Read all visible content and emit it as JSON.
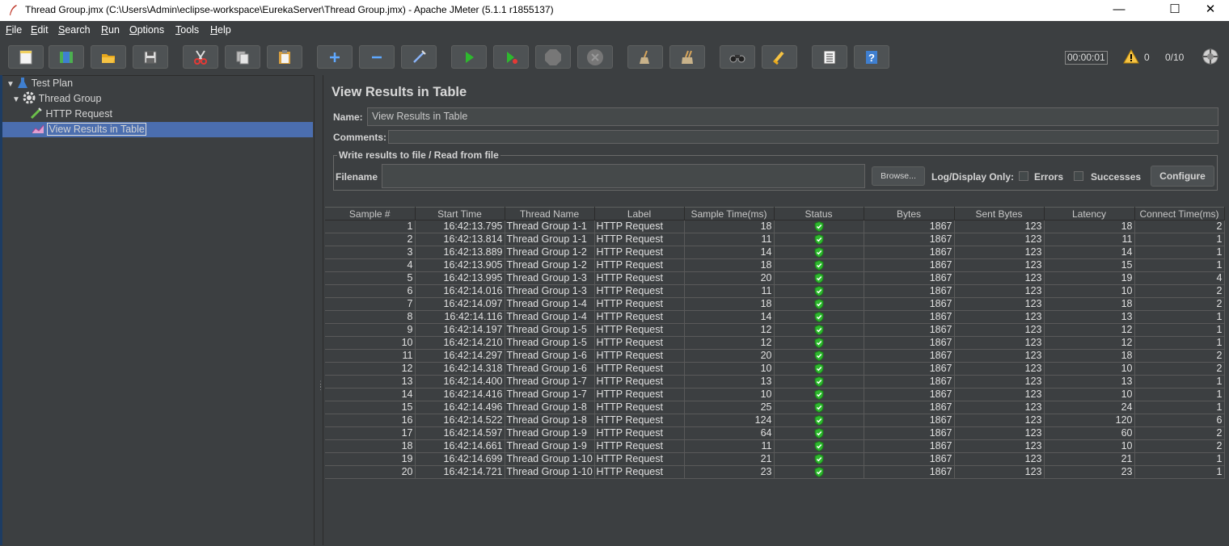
{
  "window": {
    "title": "Thread Group.jmx (C:\\Users\\Admin\\eclipse-workspace\\EurekaServer\\Thread Group.jmx) - Apache JMeter (5.1.1 r1855137)"
  },
  "menu": [
    "File",
    "Edit",
    "Search",
    "Run",
    "Options",
    "Tools",
    "Help"
  ],
  "toolbar": {
    "buttons": [
      "new-icon",
      "templates-icon",
      "open-icon",
      "save-icon",
      "cut-icon",
      "copy-icon",
      "paste-icon",
      "expand-icon",
      "collapse-icon",
      "toggle-icon",
      "start-icon",
      "start-no-pauses-icon",
      "stop-icon",
      "shutdown-icon",
      "clear-icon",
      "clear-all-icon",
      "search-icon",
      "reset-search-icon",
      "function-helper-icon",
      "help-icon"
    ],
    "timer": "00:00:01",
    "warnings": "0",
    "threads": "0/10"
  },
  "tree": {
    "items": [
      {
        "label": "Test Plan",
        "icon": "flask-icon"
      },
      {
        "label": "Thread Group",
        "icon": "gear-icon"
      },
      {
        "label": "HTTP Request",
        "icon": "pipette-icon"
      },
      {
        "label": "View Results in Table",
        "icon": "chart-icon"
      }
    ]
  },
  "panel": {
    "title": "View Results in Table",
    "name_label": "Name:",
    "name_value": "View Results in Table",
    "comments_label": "Comments:",
    "group_title": "Write results to file / Read from file",
    "filename_label": "Filename",
    "filename_value": "",
    "browse_label": "Browse...",
    "log_display_label": "Log/Display Only:",
    "errors_label": "Errors",
    "successes_label": "Successes",
    "configure_label": "Configure"
  },
  "table": {
    "columns": [
      "Sample #",
      "Start Time",
      "Thread Name",
      "Label",
      "Sample Time(ms)",
      "Status",
      "Bytes",
      "Sent Bytes",
      "Latency",
      "Connect Time(ms)"
    ],
    "rows": [
      [
        "1",
        "16:42:13.795",
        "Thread Group 1-1",
        "HTTP Request",
        "18",
        "ok",
        "1867",
        "123",
        "18",
        "2"
      ],
      [
        "2",
        "16:42:13.814",
        "Thread Group 1-1",
        "HTTP Request",
        "11",
        "ok",
        "1867",
        "123",
        "11",
        "1"
      ],
      [
        "3",
        "16:42:13.889",
        "Thread Group 1-2",
        "HTTP Request",
        "14",
        "ok",
        "1867",
        "123",
        "14",
        "1"
      ],
      [
        "4",
        "16:42:13.905",
        "Thread Group 1-2",
        "HTTP Request",
        "18",
        "ok",
        "1867",
        "123",
        "15",
        "1"
      ],
      [
        "5",
        "16:42:13.995",
        "Thread Group 1-3",
        "HTTP Request",
        "20",
        "ok",
        "1867",
        "123",
        "19",
        "4"
      ],
      [
        "6",
        "16:42:14.016",
        "Thread Group 1-3",
        "HTTP Request",
        "11",
        "ok",
        "1867",
        "123",
        "10",
        "2"
      ],
      [
        "7",
        "16:42:14.097",
        "Thread Group 1-4",
        "HTTP Request",
        "18",
        "ok",
        "1867",
        "123",
        "18",
        "2"
      ],
      [
        "8",
        "16:42:14.116",
        "Thread Group 1-4",
        "HTTP Request",
        "14",
        "ok",
        "1867",
        "123",
        "13",
        "1"
      ],
      [
        "9",
        "16:42:14.197",
        "Thread Group 1-5",
        "HTTP Request",
        "12",
        "ok",
        "1867",
        "123",
        "12",
        "1"
      ],
      [
        "10",
        "16:42:14.210",
        "Thread Group 1-5",
        "HTTP Request",
        "12",
        "ok",
        "1867",
        "123",
        "12",
        "1"
      ],
      [
        "11",
        "16:42:14.297",
        "Thread Group 1-6",
        "HTTP Request",
        "20",
        "ok",
        "1867",
        "123",
        "18",
        "2"
      ],
      [
        "12",
        "16:42:14.318",
        "Thread Group 1-6",
        "HTTP Request",
        "10",
        "ok",
        "1867",
        "123",
        "10",
        "2"
      ],
      [
        "13",
        "16:42:14.400",
        "Thread Group 1-7",
        "HTTP Request",
        "13",
        "ok",
        "1867",
        "123",
        "13",
        "1"
      ],
      [
        "14",
        "16:42:14.416",
        "Thread Group 1-7",
        "HTTP Request",
        "10",
        "ok",
        "1867",
        "123",
        "10",
        "1"
      ],
      [
        "15",
        "16:42:14.496",
        "Thread Group 1-8",
        "HTTP Request",
        "25",
        "ok",
        "1867",
        "123",
        "24",
        "1"
      ],
      [
        "16",
        "16:42:14.522",
        "Thread Group 1-8",
        "HTTP Request",
        "124",
        "ok",
        "1867",
        "123",
        "120",
        "6"
      ],
      [
        "17",
        "16:42:14.597",
        "Thread Group 1-9",
        "HTTP Request",
        "64",
        "ok",
        "1867",
        "123",
        "60",
        "2"
      ],
      [
        "18",
        "16:42:14.661",
        "Thread Group 1-9",
        "HTTP Request",
        "11",
        "ok",
        "1867",
        "123",
        "10",
        "2"
      ],
      [
        "19",
        "16:42:14.699",
        "Thread Group 1-10",
        "HTTP Request",
        "21",
        "ok",
        "1867",
        "123",
        "21",
        "1"
      ],
      [
        "20",
        "16:42:14.721",
        "Thread Group 1-10",
        "HTTP Request",
        "23",
        "ok",
        "1867",
        "123",
        "23",
        "1"
      ]
    ]
  },
  "colors": {
    "background": "#3c3f41",
    "selection": "#4b6eaf",
    "status_ok": "#2eb82e"
  }
}
